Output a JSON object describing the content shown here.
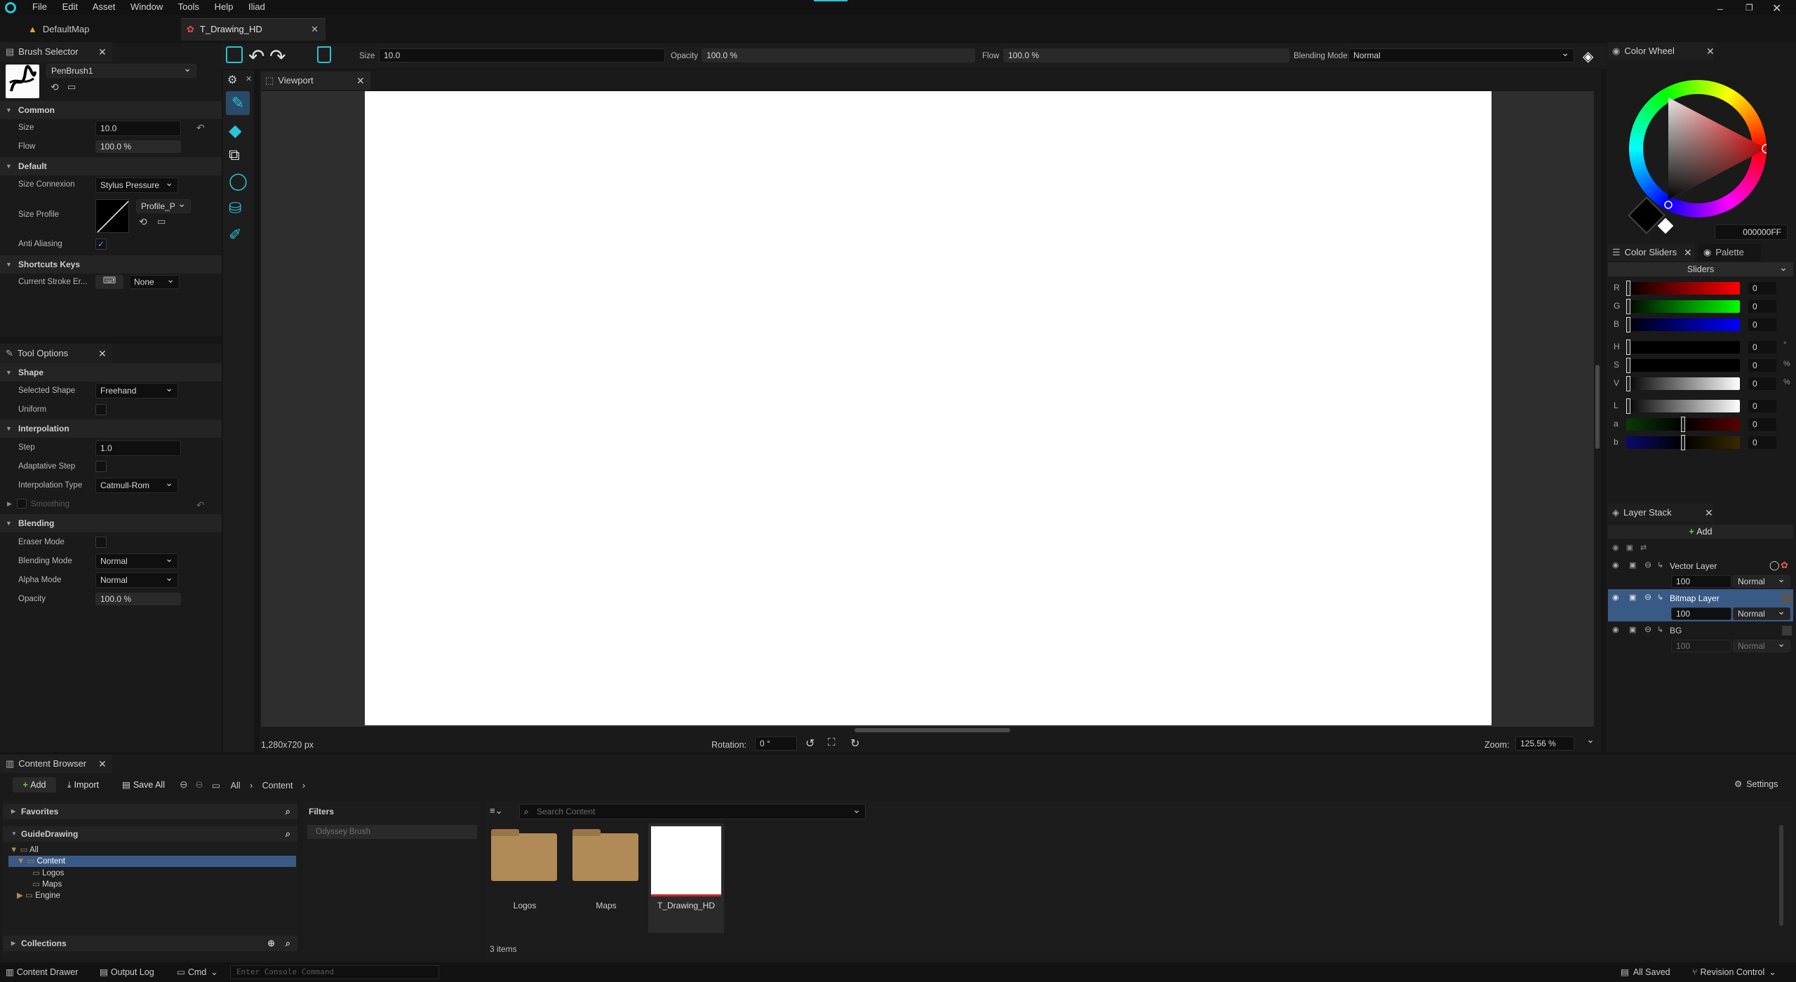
{
  "menu": {
    "items": [
      "File",
      "Edit",
      "Asset",
      "Window",
      "Tools",
      "Help",
      "Iliad"
    ]
  },
  "tabs": [
    {
      "label": "DefaultMap"
    },
    {
      "label": "T_Drawing_HD"
    }
  ],
  "toolbar": {
    "size_label": "Size",
    "size_value": "10.0",
    "opacity_label": "Opacity",
    "opacity_value": "100.0 %",
    "flow_label": "Flow",
    "flow_value": "100.0 %",
    "blend_label": "Blending Mode",
    "blend_value": "Normal"
  },
  "brush_selector": {
    "title": "Brush Selector",
    "brush_name": "PenBrush1",
    "common": {
      "title": "Common",
      "size_label": "Size",
      "size_value": "10.0",
      "flow_label": "Flow",
      "flow_value": "100.0 %"
    },
    "default": {
      "title": "Default",
      "size_connexion_label": "Size Connexion",
      "size_connexion_value": "Stylus Pressure",
      "size_profile_label": "Size Profile",
      "profile_value": "Profile_P",
      "anti_aliasing_label": "Anti Aliasing"
    },
    "shortcuts": {
      "title": "Shortcuts Keys",
      "current_stroke_label": "Current Stroke Er...",
      "current_stroke_value": "None"
    }
  },
  "tool_options": {
    "title": "Tool Options",
    "shape": {
      "title": "Shape",
      "selected_shape_label": "Selected Shape",
      "selected_shape_value": "Freehand",
      "uniform_label": "Uniform"
    },
    "interpolation": {
      "title": "Interpolation",
      "step_label": "Step",
      "step_value": "1.0",
      "adaptative_label": "Adaptative Step",
      "type_label": "Interpolation Type",
      "type_value": "Catmull-Rom",
      "smoothing_label": "Smoothing"
    },
    "blending": {
      "title": "Blending",
      "eraser_label": "Eraser Mode",
      "blend_label": "Blending Mode",
      "blend_value": "Normal",
      "alpha_label": "Alpha Mode",
      "alpha_value": "Normal",
      "opacity_label": "Opacity",
      "opacity_value": "100.0 %"
    }
  },
  "viewport": {
    "title": "Viewport",
    "resolution": "1,280x720 px",
    "rotation_label": "Rotation:",
    "rotation_value": "0 °",
    "zoom_label": "Zoom:",
    "zoom_value": "125.56 %"
  },
  "color_wheel": {
    "title": "Color Wheel",
    "hex": "000000FF"
  },
  "color_sliders": {
    "title": "Color Sliders",
    "palette_tab": "Palette",
    "mode": "Sliders",
    "rows": [
      {
        "ch": "R",
        "value": "0",
        "unit": ""
      },
      {
        "ch": "G",
        "value": "0",
        "unit": ""
      },
      {
        "ch": "B",
        "value": "0",
        "unit": ""
      },
      {
        "ch": "H",
        "value": "0",
        "unit": "°"
      },
      {
        "ch": "S",
        "value": "0",
        "unit": "%"
      },
      {
        "ch": "V",
        "value": "0",
        "unit": "%"
      },
      {
        "ch": "L",
        "value": "0",
        "unit": ""
      },
      {
        "ch": "a",
        "value": "0",
        "unit": ""
      },
      {
        "ch": "b",
        "value": "0",
        "unit": ""
      }
    ]
  },
  "layer_stack": {
    "title": "Layer Stack",
    "add_label": "Add",
    "layers": [
      {
        "name": "Vector Layer",
        "opacity": "100",
        "blend": "Normal"
      },
      {
        "name": "Bitmap Layer",
        "opacity": "100",
        "blend": "Normal"
      },
      {
        "name": "BG",
        "opacity": "100",
        "blend": "Normal"
      }
    ]
  },
  "content_browser": {
    "title": "Content Browser",
    "add_label": "Add",
    "import_label": "Import",
    "save_all_label": "Save All",
    "breadcrumb": [
      "All",
      "Content"
    ],
    "settings_label": "Settings",
    "favorites_label": "Favorites",
    "project_label": "GuideDrawing",
    "tree": [
      "All",
      "Content",
      "Logos",
      "Maps",
      "Engine"
    ],
    "collections_label": "Collections",
    "filters_label": "Filters",
    "filter_item": "Odyssey Brush",
    "search_placeholder": "Search Content",
    "assets": [
      "Logos",
      "Maps",
      "T_Drawing_HD"
    ],
    "item_count": "3 items"
  },
  "statusbar": {
    "content_drawer": "Content Drawer",
    "output_log": "Output Log",
    "cmd": "Cmd",
    "console_placeholder": "Enter Console Command",
    "all_saved": "All Saved",
    "revision_control": "Revision Control"
  },
  "colors": {
    "accent": "#2cc3d6",
    "selection": "#3a5a86",
    "folder": "#b08a57"
  }
}
